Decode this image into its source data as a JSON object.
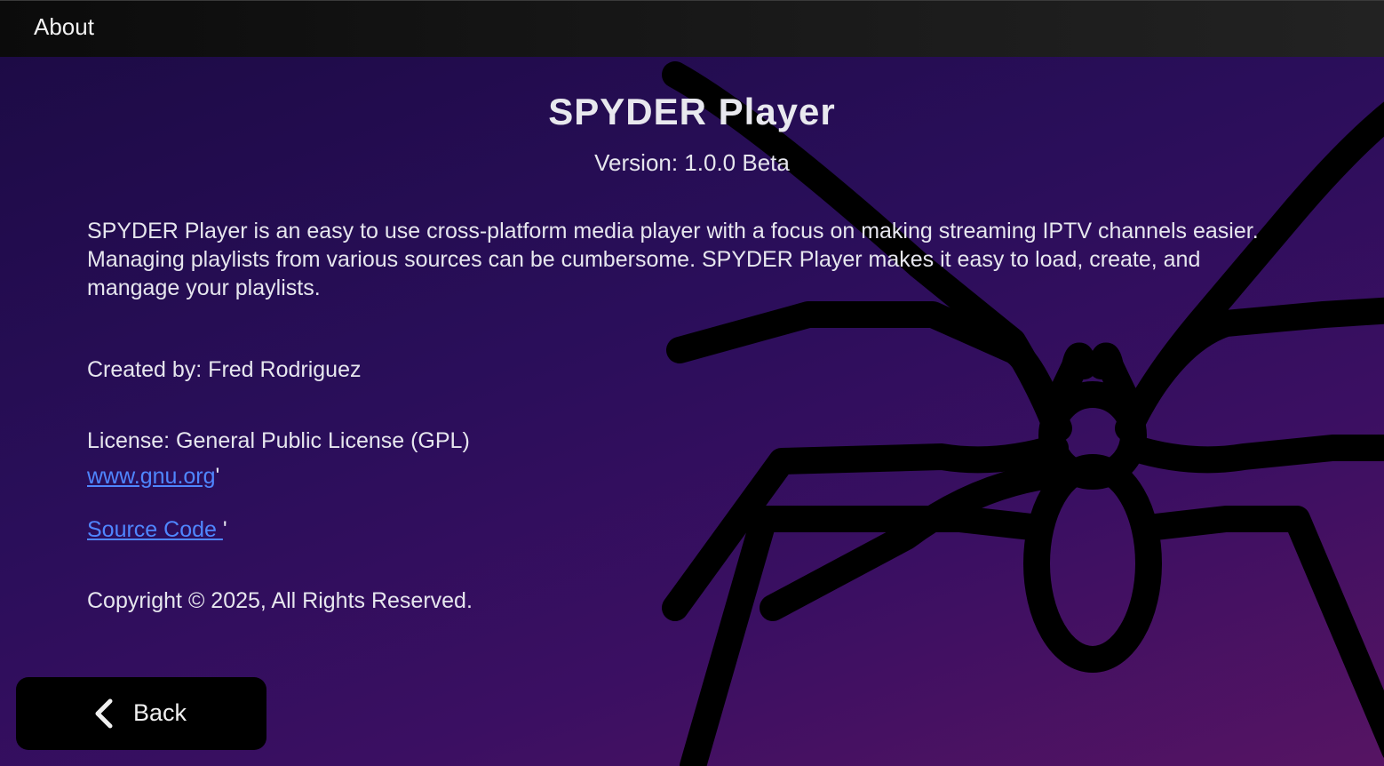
{
  "window": {
    "title": "About"
  },
  "about": {
    "app_name": "SPYDER Player",
    "version": "Version: 1.0.0 Beta",
    "description": "SPYDER Player is an easy to use cross-platform media player with a focus on making streaming IPTV channels easier.  Managing playlists from various sources can be cumbersome.  SPYDER Player makes it easy to load, create, and mangage your playlists.",
    "created_by": "Created by:  Fred Rodriguez",
    "license": "License:  General Public License (GPL)",
    "gnu_link": "www.gnu.org",
    "gnu_suffix": "'",
    "source_link": "Source Code ",
    "source_suffix": " '",
    "copyright": "Copyright © 2025, All Rights Reserved."
  },
  "back_button": {
    "label": "Back",
    "icon": "chevron-left-icon"
  },
  "background": {
    "icon": "spider-icon"
  },
  "colors": {
    "link": "#4f86ff",
    "background_top": "#1d0b46",
    "background_bottom": "#561463"
  }
}
